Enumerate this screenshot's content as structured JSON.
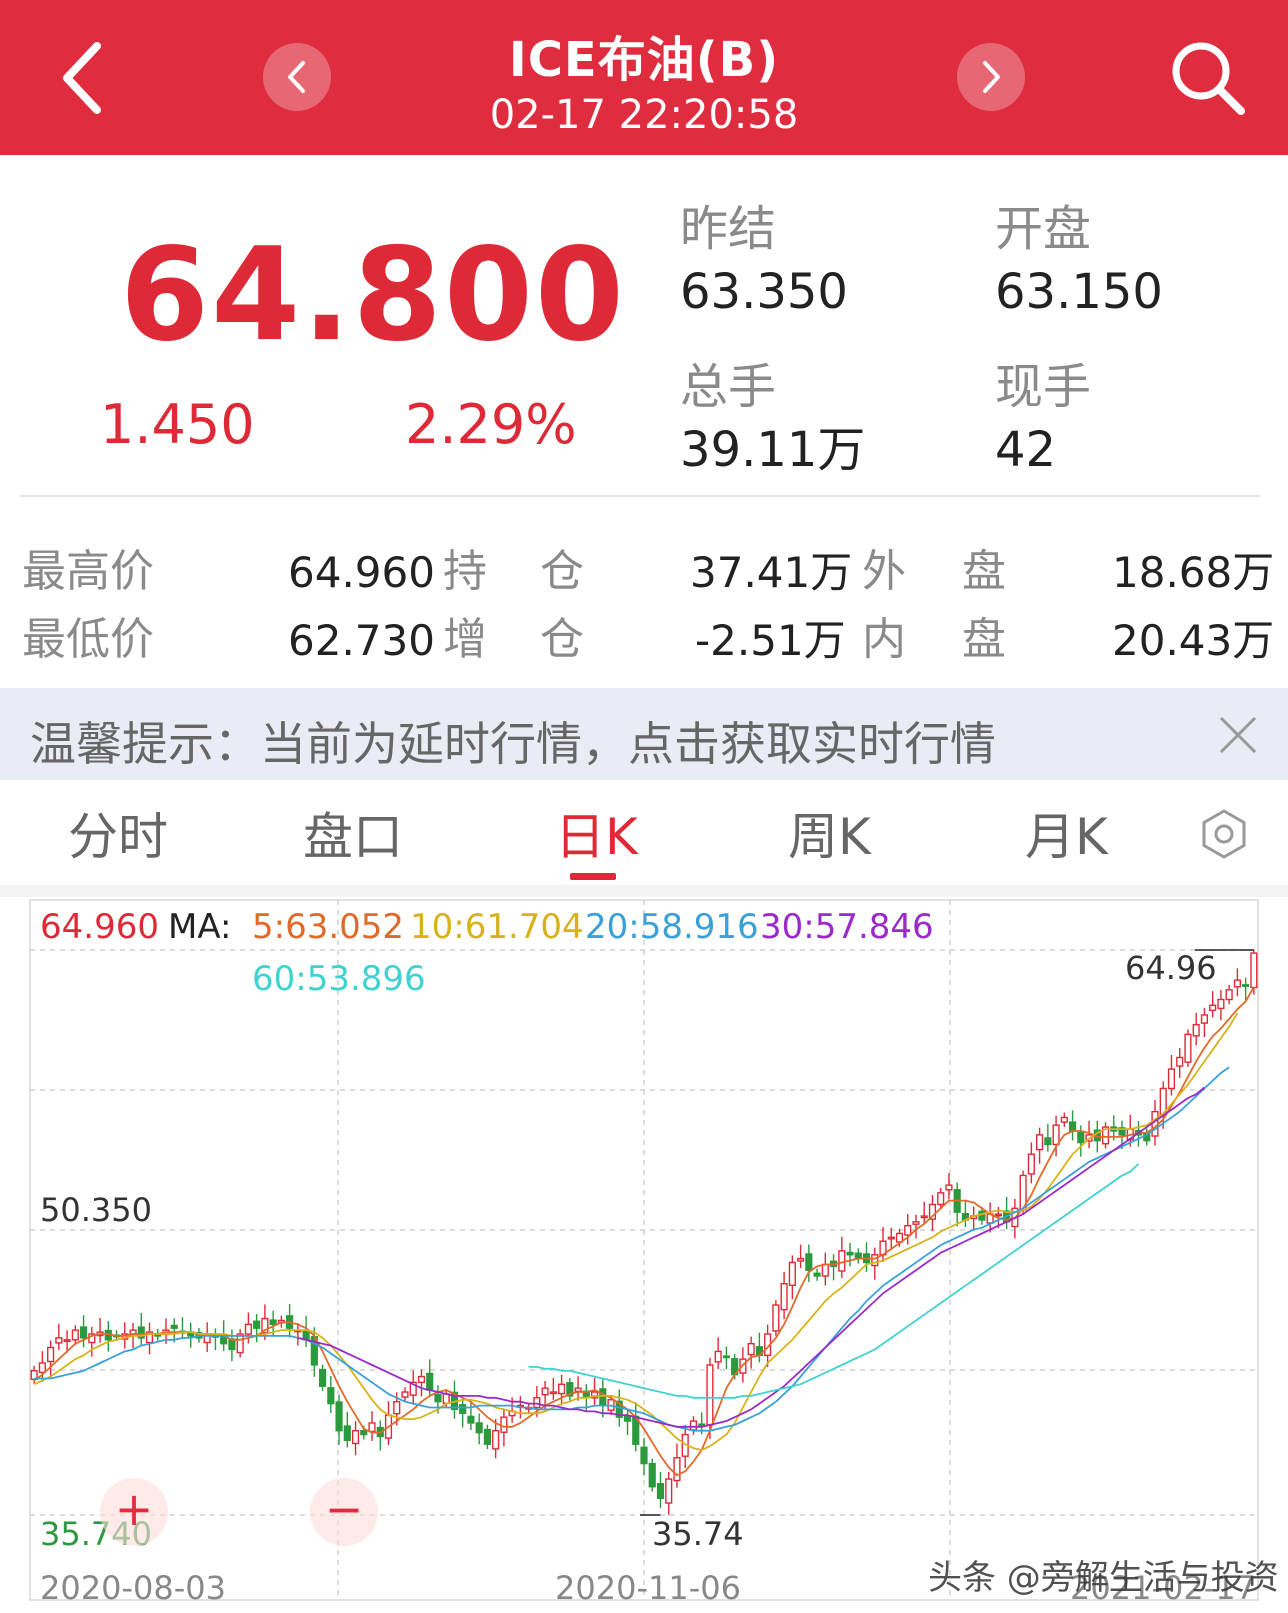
{
  "header": {
    "title": "ICE布油(B)",
    "time": "02-17 22:20:58"
  },
  "quote": {
    "price": "64.800",
    "change": "1.450",
    "change_pct": "2.29%",
    "prev_settle_label": "昨结",
    "prev_settle": "63.350",
    "open_label": "开盘",
    "open": "63.150",
    "volume_label": "总手",
    "volume": "39.11万",
    "last_lot_label": "现手",
    "last_lot": "42"
  },
  "stats": {
    "high_label": "最高价",
    "high": "64.960",
    "low_label": "最低价",
    "low": "62.730",
    "oi_label_a": "持",
    "oi_label_b": "仓",
    "oi": "37.41万",
    "oi_chg_label_a": "增",
    "oi_chg_label_b": "仓",
    "oi_chg": "-2.51万",
    "outer_label_a": "外",
    "outer_label_b": "盘",
    "outer": "18.68万",
    "inner_label_a": "内",
    "inner_label_b": "盘",
    "inner": "20.43万"
  },
  "notice": {
    "text": "温馨提示：当前为延时行情，点击获取实时行情"
  },
  "tabs": [
    {
      "label": "分时"
    },
    {
      "label": "盘口"
    },
    {
      "label": "日K"
    },
    {
      "label": "周K"
    },
    {
      "label": "月K"
    }
  ],
  "active_tab": "日K",
  "chart_meta": {
    "high_price": "64.960",
    "ma_label": "MA:",
    "ma5": "5:63.052",
    "ma10": "10:61.704",
    "ma20": "20:58.916",
    "ma30": "30:57.846",
    "ma60": "60:53.896",
    "mid_label": "50.350",
    "low_label": "35.740",
    "max_marker": "64.96",
    "min_marker": "35.74",
    "dates": [
      "2020-08-03",
      "2020-11-06",
      "2021-02-17"
    ],
    "zoom_in": "+",
    "zoom_out": "−",
    "watermark": "头条 @旁解生活与投资"
  },
  "colors": {
    "up": "#de2a37",
    "down": "#2a9a3d",
    "ma5": "#e06a2a",
    "ma10": "#d9b21a",
    "ma20": "#3aa0d8",
    "ma30": "#9a2bc8",
    "ma60": "#3fd2d0"
  },
  "chart_data": {
    "type": "candlestick",
    "ylim": [
      35.74,
      64.96
    ],
    "x_labels": [
      "2020-08-03",
      "2020-11-06",
      "2021-02-17"
    ],
    "annotations": {
      "max": 64.96,
      "min": 35.74
    },
    "series": [
      {
        "name": "MA5",
        "last": 63.052
      },
      {
        "name": "MA10",
        "last": 61.704
      },
      {
        "name": "MA20",
        "last": 58.916
      },
      {
        "name": "MA30",
        "last": 57.846
      },
      {
        "name": "MA60",
        "last": 53.896
      }
    ],
    "close": [
      43.2,
      43.6,
      44.4,
      44.9,
      44.8,
      45.3,
      44.9,
      45.1,
      45.2,
      44.8,
      45.0,
      45.1,
      45.3,
      44.9,
      45.2,
      45.0,
      45.3,
      45.4,
      45.2,
      45.0,
      44.9,
      45.1,
      45.0,
      44.6,
      44.3,
      45.1,
      45.6,
      45.4,
      45.9,
      45.6,
      45.8,
      45.4,
      45.3,
      44.8,
      43.5,
      42.4,
      41.5,
      40.1,
      39.6,
      40.1,
      39.9,
      40.5,
      39.8,
      40.9,
      41.6,
      42.1,
      42.6,
      42.9,
      42.2,
      41.6,
      42.0,
      41.2,
      41.0,
      40.5,
      40.0,
      39.4,
      40.1,
      40.8,
      41.1,
      41.4,
      41.3,
      41.8,
      42.3,
      42.1,
      42.5,
      41.9,
      42.3,
      41.8,
      42.1,
      41.4,
      41.7,
      40.8,
      40.6,
      39.4,
      38.4,
      37.2,
      36.6,
      37.6,
      38.7,
      39.9,
      40.6,
      40.4,
      43.5,
      44.2,
      43.9,
      43.0,
      43.8,
      44.6,
      44.0,
      45.1,
      46.6,
      47.7,
      48.8,
      49.0,
      48.4,
      48.1,
      48.7,
      48.6,
      49.4,
      49.2,
      49.0,
      48.8,
      49.2,
      49.9,
      50.1,
      50.3,
      50.7,
      50.9,
      51.2,
      51.8,
      52.4,
      52.8,
      51.4,
      51.0,
      51.2,
      51.0,
      51.3,
      51.3,
      50.9,
      51.6,
      53.3,
      54.4,
      55.4,
      54.9,
      55.9,
      56.3,
      55.6,
      55.0,
      55.4,
      55.1,
      55.8,
      55.6,
      55.4,
      55.7,
      55.4,
      55.1,
      56.6,
      57.8,
      58.8,
      59.4,
      60.6,
      61.1,
      61.6,
      62.1,
      62.4,
      62.9,
      63.4,
      63.1,
      64.8
    ],
    "mas": {
      "ma5": [
        42.7,
        43.0,
        43.4,
        43.8,
        44.2,
        44.6,
        44.8,
        45.0,
        45.1,
        45.1,
        45.0,
        45.0,
        45.1,
        45.1,
        45.1,
        45.1,
        45.2,
        45.2,
        45.2,
        45.2,
        45.1,
        45.1,
        45.1,
        45.0,
        44.8,
        44.8,
        44.9,
        45.0,
        45.3,
        45.5,
        45.7,
        45.7,
        45.6,
        45.4,
        45.0,
        44.2,
        43.3,
        42.4,
        41.6,
        40.9,
        40.2,
        40.0,
        40.0,
        40.3,
        40.6,
        40.9,
        41.2,
        41.6,
        41.9,
        42.1,
        42.2,
        42.0,
        41.8,
        41.6,
        41.2,
        40.8,
        40.5,
        40.3,
        40.3,
        40.5,
        40.8,
        41.1,
        41.4,
        41.6,
        41.8,
        42.0,
        42.1,
        42.1,
        42.2,
        42.0,
        41.8,
        41.5,
        41.2,
        40.8,
        40.2,
        39.5,
        38.8,
        38.2,
        37.8,
        38.0,
        38.5,
        39.1,
        40.1,
        41.2,
        42.3,
        43.0,
        43.5,
        43.9,
        44.0,
        44.4,
        44.9,
        45.6,
        46.5,
        47.5,
        48.3,
        48.6,
        48.7,
        48.7,
        48.8,
        48.9,
        49.0,
        49.0,
        49.0,
        49.2,
        49.5,
        49.8,
        50.1,
        50.5,
        50.8,
        51.2,
        51.6,
        52.0,
        52.0,
        52.0,
        51.9,
        51.6,
        51.3,
        51.1,
        51.0,
        51.1,
        51.6,
        52.3,
        53.2,
        54.0,
        54.8,
        55.4,
        55.6,
        55.6,
        55.5,
        55.3,
        55.3,
        55.3,
        55.3,
        55.4,
        55.5,
        55.5,
        55.8,
        56.2,
        56.9,
        57.6,
        58.4,
        59.2,
        59.9,
        60.5,
        60.9,
        61.4,
        61.9,
        62.3,
        63.05
      ],
      "ma10": [
        42.5,
        42.7,
        42.9,
        43.2,
        43.5,
        43.8,
        44.0,
        44.3,
        44.5,
        44.7,
        44.8,
        44.9,
        45.0,
        45.0,
        45.1,
        45.1,
        45.1,
        45.1,
        45.2,
        45.2,
        45.1,
        45.1,
        45.1,
        45.1,
        45.0,
        45.0,
        45.0,
        45.0,
        45.1,
        45.2,
        45.3,
        45.3,
        45.3,
        45.3,
        45.2,
        44.9,
        44.5,
        44.0,
        43.5,
        42.9,
        42.3,
        41.7,
        41.2,
        40.9,
        40.8,
        40.7,
        40.7,
        40.8,
        41.0,
        41.2,
        41.5,
        41.6,
        41.7,
        41.7,
        41.6,
        41.5,
        41.3,
        41.2,
        41.1,
        41.0,
        41.0,
        41.0,
        41.1,
        41.3,
        41.5,
        41.6,
        41.8,
        41.8,
        41.9,
        41.9,
        41.9,
        41.8,
        41.7,
        41.5,
        41.2,
        40.9,
        40.5,
        40.1,
        39.7,
        39.4,
        39.2,
        39.1,
        39.3,
        39.6,
        39.9,
        40.5,
        41.3,
        42.1,
        42.9,
        43.6,
        44.0,
        44.4,
        44.8,
        45.3,
        45.8,
        46.3,
        46.8,
        47.2,
        47.5,
        47.9,
        48.3,
        48.7,
        48.8,
        48.9,
        49.1,
        49.3,
        49.5,
        49.7,
        49.9,
        50.1,
        50.4,
        50.6,
        50.8,
        51.0,
        51.2,
        51.3,
        51.4,
        51.5,
        51.4,
        51.4,
        51.5,
        51.7,
        52.1,
        52.6,
        53.2,
        53.8,
        54.4,
        54.8,
        55.2,
        55.5,
        55.7,
        55.7,
        55.7,
        55.7,
        55.8,
        55.9,
        56.2,
        56.5,
        57.0,
        57.5,
        58.0,
        58.6,
        59.2,
        59.8,
        60.4,
        61.0,
        61.7
      ],
      "ma20": [
        42.8,
        42.8,
        42.8,
        42.9,
        43.0,
        43.1,
        43.2,
        43.4,
        43.6,
        43.8,
        44.0,
        44.2,
        44.3,
        44.5,
        44.6,
        44.7,
        44.8,
        44.8,
        44.9,
        44.9,
        45.0,
        45.0,
        45.0,
        45.0,
        45.0,
        45.0,
        45.0,
        45.0,
        45.0,
        45.0,
        45.0,
        45.0,
        44.9,
        44.8,
        44.6,
        44.4,
        44.1,
        43.8,
        43.5,
        43.2,
        42.9,
        42.6,
        42.3,
        42.0,
        41.8,
        41.6,
        41.5,
        41.4,
        41.3,
        41.3,
        41.3,
        41.3,
        41.3,
        41.3,
        41.4,
        41.4,
        41.4,
        41.4,
        41.4,
        41.3,
        41.3,
        41.2,
        41.2,
        41.2,
        41.2,
        41.2,
        41.3,
        41.3,
        41.4,
        41.4,
        41.4,
        41.3,
        41.2,
        41.1,
        41.0,
        40.8,
        40.6,
        40.4,
        40.3,
        40.2,
        40.1,
        40.1,
        40.1,
        40.2,
        40.3,
        40.4,
        40.6,
        40.8,
        41.0,
        41.3,
        41.6,
        42.0,
        42.4,
        42.9,
        43.4,
        43.9,
        44.4,
        44.9,
        45.4,
        45.9,
        46.3,
        46.8,
        47.2,
        47.6,
        47.9,
        48.2,
        48.5,
        48.8,
        49.1,
        49.4,
        49.7,
        49.9,
        50.1,
        50.3,
        50.5,
        50.6,
        50.8,
        51.0,
        51.2,
        51.4,
        51.6,
        51.9,
        52.2,
        52.5,
        52.8,
        53.1,
        53.4,
        53.7,
        54.0,
        54.2,
        54.4,
        54.6,
        54.8,
        55.0,
        55.2,
        55.4,
        55.7,
        56.0,
        56.3,
        56.6,
        57.0,
        57.4,
        57.8,
        58.2,
        58.6,
        58.9
      ],
      "ma30": [
        null,
        null,
        null,
        null,
        null,
        null,
        null,
        null,
        null,
        null,
        null,
        null,
        null,
        null,
        null,
        null,
        null,
        null,
        null,
        null,
        null,
        null,
        null,
        null,
        null,
        null,
        null,
        null,
        null,
        null,
        null,
        null,
        44.9,
        44.8,
        44.7,
        44.6,
        44.5,
        44.3,
        44.1,
        43.9,
        43.7,
        43.5,
        43.3,
        43.1,
        42.9,
        42.7,
        42.5,
        42.3,
        42.2,
        42.1,
        42.0,
        41.9,
        41.9,
        41.9,
        41.9,
        41.8,
        41.8,
        41.7,
        41.6,
        41.6,
        41.5,
        41.5,
        41.4,
        41.4,
        41.3,
        41.2,
        41.2,
        41.1,
        41.1,
        41.0,
        41.0,
        40.9,
        40.9,
        40.8,
        40.7,
        40.6,
        40.5,
        40.4,
        40.3,
        40.3,
        40.3,
        40.3,
        40.4,
        40.5,
        40.6,
        40.8,
        41.0,
        41.2,
        41.5,
        41.8,
        42.1,
        42.4,
        42.8,
        43.2,
        43.6,
        44.0,
        44.4,
        44.8,
        45.2,
        45.6,
        46.0,
        46.4,
        46.8,
        47.2,
        47.5,
        47.8,
        48.1,
        48.4,
        48.7,
        49.0,
        49.3,
        49.5,
        49.7,
        49.9,
        50.1,
        50.3,
        50.5,
        50.7,
        50.9,
        51.1,
        51.3,
        51.6,
        51.9,
        52.2,
        52.5,
        52.8,
        53.1,
        53.4,
        53.7,
        54.0,
        54.3,
        54.6,
        54.9,
        55.2,
        55.5,
        55.8,
        56.1,
        56.4,
        56.7,
        57.0,
        57.3,
        57.5,
        57.85
      ],
      "ma60": [
        null,
        null,
        null,
        null,
        null,
        null,
        null,
        null,
        null,
        null,
        null,
        null,
        null,
        null,
        null,
        null,
        null,
        null,
        null,
        null,
        null,
        null,
        null,
        null,
        null,
        null,
        null,
        null,
        null,
        null,
        null,
        null,
        null,
        null,
        null,
        null,
        null,
        null,
        null,
        null,
        null,
        null,
        null,
        null,
        null,
        null,
        null,
        null,
        null,
        null,
        null,
        null,
        null,
        null,
        null,
        null,
        null,
        null,
        null,
        null,
        43.4,
        43.4,
        43.3,
        43.3,
        43.2,
        43.2,
        43.1,
        43.0,
        42.9,
        42.8,
        42.7,
        42.6,
        42.5,
        42.4,
        42.3,
        42.2,
        42.1,
        42.0,
        41.9,
        41.9,
        41.8,
        41.8,
        41.8,
        41.8,
        41.8,
        41.8,
        41.9,
        41.9,
        42.0,
        42.1,
        42.2,
        42.3,
        42.4,
        42.5,
        42.7,
        42.9,
        43.1,
        43.3,
        43.5,
        43.7,
        43.9,
        44.1,
        44.3,
        44.6,
        44.9,
        45.2,
        45.5,
        45.8,
        46.1,
        46.4,
        46.7,
        47.0,
        47.3,
        47.6,
        47.9,
        48.2,
        48.5,
        48.8,
        49.1,
        49.4,
        49.7,
        50.0,
        50.3,
        50.6,
        50.9,
        51.2,
        51.5,
        51.8,
        52.1,
        52.4,
        52.7,
        53.0,
        53.3,
        53.5,
        53.9
      ]
    }
  }
}
